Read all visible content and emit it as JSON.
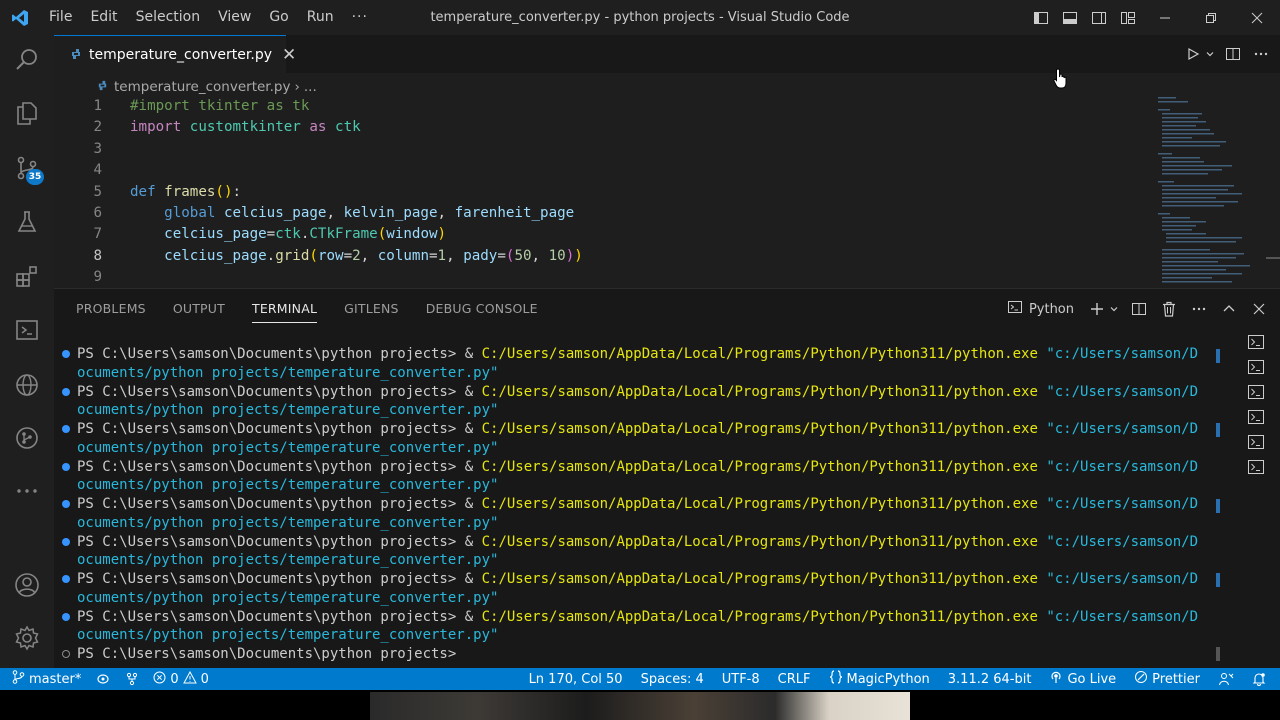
{
  "window": {
    "title": "temperature_converter.py - python projects - Visual Studio Code",
    "menu": [
      "File",
      "Edit",
      "Selection",
      "View",
      "Go",
      "Run",
      "···"
    ]
  },
  "activity_bar": {
    "source_control_badge": "35"
  },
  "editor": {
    "tab_label": "temperature_converter.py",
    "breadcrumb": [
      "temperature_converter.py",
      "..."
    ],
    "line_numbers": [
      "1",
      "2",
      "3",
      "4",
      "5",
      "6",
      "7",
      "8",
      "9"
    ]
  },
  "panel": {
    "tabs": [
      "PROBLEMS",
      "OUTPUT",
      "TERMINAL",
      "GITLENS",
      "DEBUG CONSOLE"
    ],
    "active_tab": "TERMINAL",
    "terminal_profile": "Python",
    "prompt": "PS C:\\Users\\samson\\Documents\\python projects> ",
    "command_amp": "& ",
    "exe_path": "C:/Users/samson/AppData/Local/Programs/Python/Python311/python.exe",
    "arg_start": " \"c:/Users/samson/D",
    "arg_cont": "ocuments/python projects/temperature_converter.py\"",
    "last_prompt": "PS C:\\Users\\samson\\Documents\\python projects> ",
    "run_count": 8
  },
  "status_bar": {
    "branch": "master*",
    "errors": "0",
    "warnings": "0",
    "position": "Ln 170, Col 50",
    "spaces": "Spaces: 4",
    "encoding": "UTF-8",
    "eol": "CRLF",
    "magic": "MagicPython",
    "interpreter": "3.11.2 64-bit",
    "golive": "Go Live",
    "prettier": "Prettier"
  },
  "colors": {
    "accent": "#007acc",
    "terminal_path": "#e5e510",
    "terminal_string": "#29b8db"
  }
}
